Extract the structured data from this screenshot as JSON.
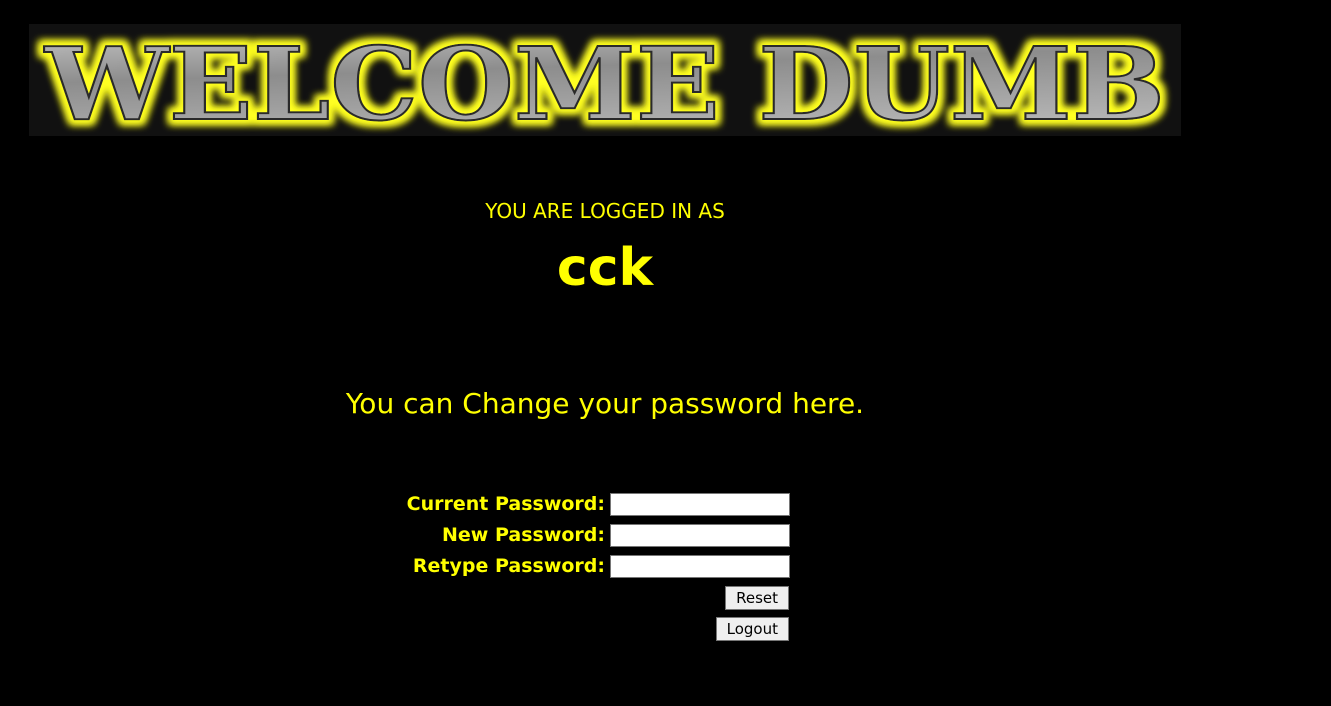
{
  "banner": {
    "text": "WELCOME DUMB",
    "glow_color": "#ffff33",
    "letter_color": "#9a9a9a"
  },
  "session": {
    "logged_in_label": "YOU ARE LOGGED IN AS",
    "username": "cck"
  },
  "main": {
    "change_password_text": "You can Change your password here."
  },
  "form": {
    "current_password_label": "Current Password:",
    "new_password_label": "New Password:",
    "retype_password_label": "Retype Password:",
    "current_password_value": "",
    "new_password_value": "",
    "retype_password_value": "",
    "reset_label": "Reset",
    "logout_label": "Logout"
  },
  "colors": {
    "background": "#000000",
    "text": "#ffff00"
  }
}
